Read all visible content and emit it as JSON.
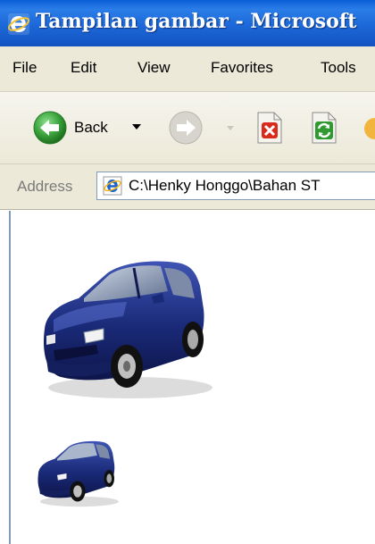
{
  "window": {
    "title": "Tampilan gambar - Microsoft"
  },
  "menu": {
    "items": [
      "File",
      "Edit",
      "View",
      "Favorites",
      "Tools"
    ]
  },
  "toolbar": {
    "back_label": "Back",
    "icons": [
      "back-arrow-icon",
      "dropdown-arrow-icon",
      "forward-arrow-icon",
      "stop-icon",
      "refresh-icon"
    ]
  },
  "address": {
    "label": "Address",
    "value": "C:\\Henky Honggo\\Bahan ST"
  },
  "content": {
    "images": [
      "large-car-image",
      "small-car-image"
    ]
  },
  "colors": {
    "titlebar": "#1c68d8",
    "chrome": "#ece9d8",
    "back_green": "#3aa13a",
    "stop_red": "#d92a1c",
    "refresh_green": "#2f9a2f",
    "car_blue": "#1a2a78"
  }
}
